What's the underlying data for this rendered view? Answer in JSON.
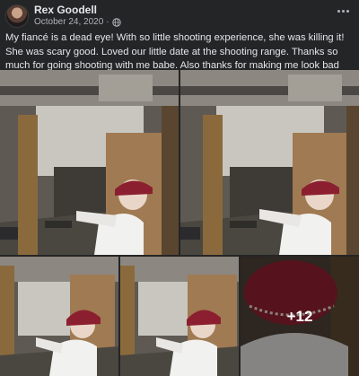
{
  "post": {
    "author": "Rex Goodell",
    "date": "October 24, 2020",
    "separator": "·",
    "privacy_icon": "globe-icon",
    "caption": "My fiancé is a dead eye! With so little shooting experience, she was killing it! She was scary good. Loved our little date at the shooting range. Thanks so much for going shooting with me babe. Also thanks for making me look bad with your good shooting."
  },
  "photos": {
    "more_count": "+12"
  },
  "colors": {
    "background": "#242526",
    "text_primary": "#e4e6eb",
    "text_secondary": "#b0b3b8"
  }
}
